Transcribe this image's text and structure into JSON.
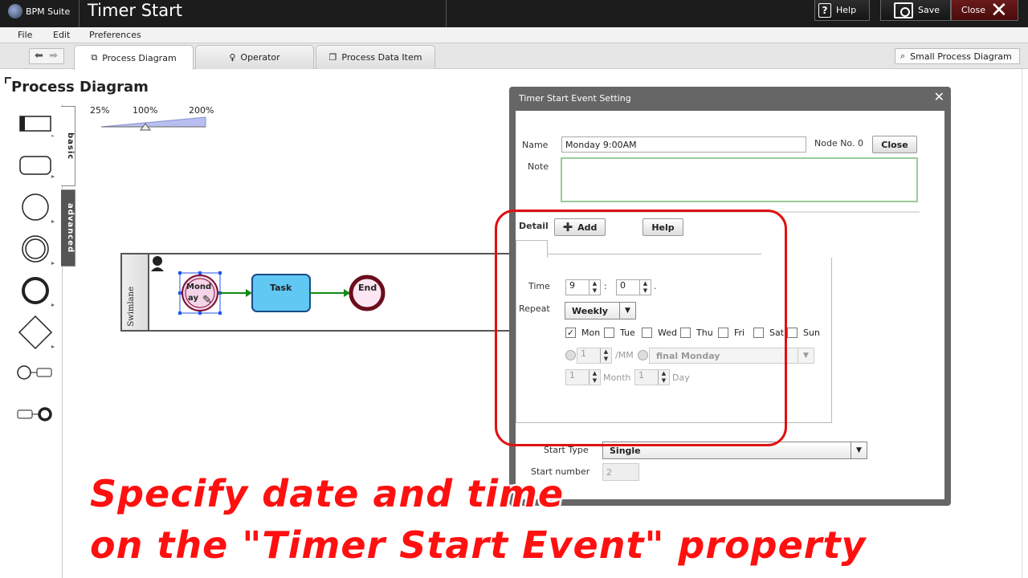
{
  "app": {
    "logo_text": "BPM Suite",
    "title": "Timer Start"
  },
  "topbar": {
    "help_label": "Help",
    "save_label": "Save",
    "close_label": "Close"
  },
  "menu": [
    "File",
    "Edit",
    "Preferences"
  ],
  "tabs": [
    {
      "label": "Process Diagram",
      "icon": "diagram-icon",
      "active": true
    },
    {
      "label": "Operator",
      "icon": "person-icon",
      "active": false
    },
    {
      "label": "Process Data Item",
      "icon": "data-item-icon",
      "active": false
    }
  ],
  "small_diagram_label": "Small Process Diagram",
  "canvas": {
    "title": "Process Diagram",
    "palette_tabs": [
      "basic",
      "advanced"
    ],
    "zoom_labels": [
      "25%",
      "100%",
      "200%"
    ],
    "swimlane_label": "Swimlane",
    "nodes": {
      "start_label_line1": "Mond",
      "start_label_line2": "ay",
      "task_label": "Task",
      "end_label": "End"
    }
  },
  "dialog": {
    "title": "Timer Start Event Setting",
    "name_label": "Name",
    "name_value": "Monday 9:00AM",
    "node_no": "Node No. 0",
    "close_button": "Close",
    "note_label": "Note",
    "note_value": "",
    "detail_label": "Detail",
    "add_button": "Add",
    "help_button": "Help",
    "time_label": "Time",
    "hour": "9",
    "minute": "0",
    "repeat_label": "Repeat",
    "repeat_value": "Weekly",
    "days": [
      {
        "label": "Mon",
        "checked": true
      },
      {
        "label": "Tue",
        "checked": false
      },
      {
        "label": "Wed",
        "checked": false
      },
      {
        "label": "Thu",
        "checked": false
      },
      {
        "label": "Fri",
        "checked": false
      },
      {
        "label": "Sat",
        "checked": false
      },
      {
        "label": "Sun",
        "checked": false
      }
    ],
    "monthly_day": "1",
    "mm_label": "/MM",
    "monthly_option": "final Monday",
    "yearly_month": "1",
    "month_label": "Month",
    "yearly_day": "1",
    "day_label": "Day",
    "start_type_label": "Start Type",
    "start_type_value": "Single",
    "start_number_label": "Start number",
    "start_number_value": "2"
  },
  "caption": {
    "line1": "Specify date and time",
    "line2": "on the \"Timer Start Event\" property"
  },
  "colors": {
    "highlight": "#e01010",
    "caption": "#ff1010",
    "task_fill": "#5ec8f0",
    "end_stroke": "#6a0d1c"
  }
}
